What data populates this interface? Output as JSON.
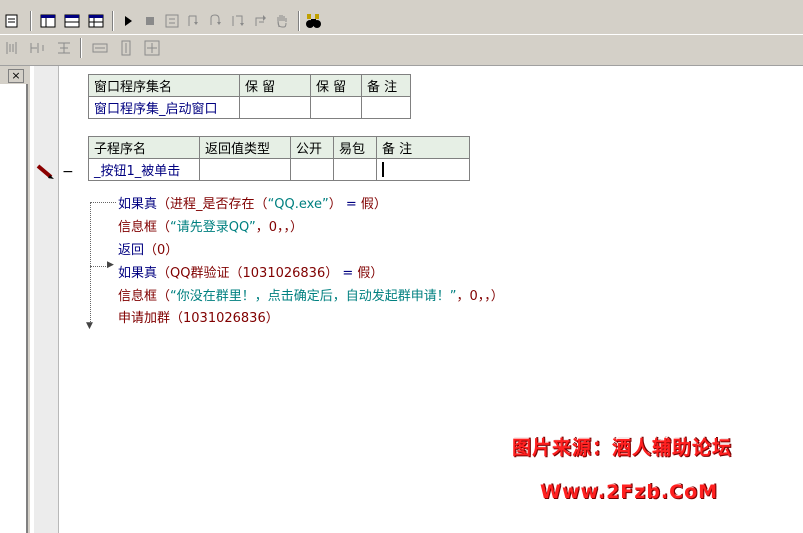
{
  "toolbar": {
    "row1": [
      "document-icon",
      "window-layout-icon",
      "split-view-icon",
      "grid-view-icon",
      "run-icon",
      "stop-icon",
      "step-icon",
      "step-into-icon",
      "step-over-icon",
      "step-out-icon",
      "run-to-cursor-icon",
      "hand-icon",
      "binoculars-icon"
    ],
    "row2": [
      "align-left-icon",
      "align-center-icon",
      "align-top-icon",
      "same-width-icon",
      "same-height-icon",
      "same-size-icon"
    ]
  },
  "left_panel": {
    "close_label": "×"
  },
  "window_table": {
    "headers": [
      "窗口程序集名",
      "保 留",
      "保 留",
      "备 注"
    ],
    "row": [
      "窗口程序集_启动窗口",
      "",
      "",
      ""
    ]
  },
  "sub_table": {
    "headers": [
      "子程序名",
      "返回值类型",
      "公开",
      "易包",
      "备 注"
    ],
    "row": [
      "_按钮1_被单击",
      "",
      "",
      "",
      ""
    ]
  },
  "code": {
    "line1": {
      "kw": "如果真",
      "p1": "（",
      "fn": "进程_是否存在",
      "p2": "（",
      "str": "“QQ.exe”",
      "p3": "）",
      "op": " = ",
      "val": "假",
      "p4": "）"
    },
    "line2": {
      "fn": "信息框",
      "p1": "（",
      "str": "“请先登录QQ”",
      "rest": "，0，，）"
    },
    "line3": {
      "kw": "返回",
      "rest": "（0）"
    },
    "line4": {
      "kw": "如果真",
      "p1": "（",
      "fn": "QQ群验证",
      "args": "（1031026836）",
      "op": " = ",
      "val": "假",
      "p2": "）"
    },
    "line5": {
      "fn": "信息框",
      "p1": "（",
      "str": "“你没在群里！，点击确定后，自动发起群申请！”",
      "rest": "，0，，）"
    },
    "line6": {
      "kw": "申请加群",
      "rest": "（1031026836）"
    }
  },
  "watermark": {
    "line1": "图片来源：酒人辅助论坛",
    "line2": "Www.2Fzb.CoM"
  },
  "colors": {
    "keyword": "#000080",
    "function": "#800000",
    "string": "#008080",
    "table_header": "#e6efe5",
    "watermark": "#ff2020"
  }
}
